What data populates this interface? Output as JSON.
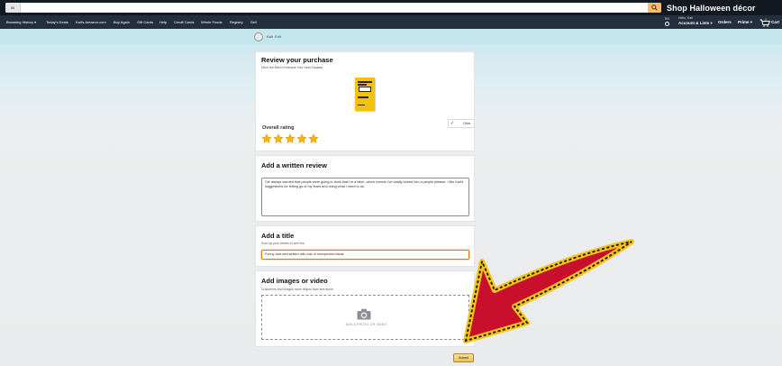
{
  "header": {
    "dept_label": "All",
    "promo_text": "Shop Halloween décor",
    "accent_color": "#febd69"
  },
  "nav": {
    "links": [
      "Browsing History ▾",
      "Today's Deals",
      "Kali's Amazon.com",
      "Buy Again",
      "Gift Cards",
      "Help",
      "Credit Cards",
      "Whole Foods",
      "Registry",
      "Sell"
    ],
    "lang": "EN",
    "account_greeting": "Hello, Kali",
    "account_lists": "Account & Lists ▾",
    "orders": "Orders",
    "prime": "Prime ▾",
    "cart_label": "Cart",
    "cart_count": "0"
  },
  "profile": {
    "name": "Kali",
    "edit_label": "Edit"
  },
  "review_purchase": {
    "heading": "Review your purchase",
    "product_title": "Ditch the Bitch! Embrace Your Inner Badass",
    "clear_label": "Clear",
    "overall_rating_label": "Overall rating",
    "rating": 5,
    "star_color": "#f5b50a"
  },
  "written_review": {
    "heading": "Add a written review",
    "text": "I've always worried that people were going to think that I'm a bitch, which means I've totally turned into a people pleaser. I like Kali's suggestions for letting go of my fears and doing what I need to do."
  },
  "title_section": {
    "heading": "Add a title",
    "subtitle": "Sum up your review in one line",
    "value": "Funny and well written with lots of unexpected ideas"
  },
  "media_section": {
    "heading": "Add images or video",
    "subtitle": "Customers find images more helpful than text alone.",
    "drop_text": "ADD A PHOTO OR VIDEO",
    "camera_icon": "camera-icon"
  },
  "submit_label": "Submit",
  "annotation_arrow": {
    "fill_color": "#c8102e",
    "border_color": "#f5c518"
  }
}
